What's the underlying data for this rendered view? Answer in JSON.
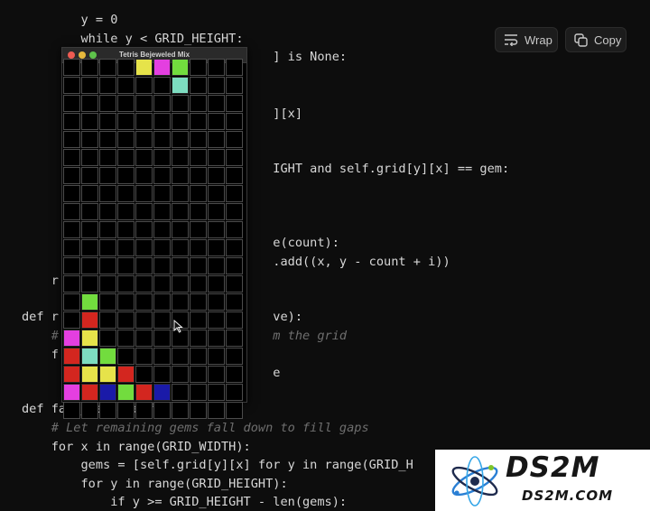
{
  "toolbar": {
    "wrap_label": "Wrap",
    "copy_label": "Copy"
  },
  "window": {
    "title": "Tetris Bejeweled Mix"
  },
  "code": {
    "lines": [
      "    for x in range(GRID_WIDTH):",
      "        y = 0",
      "        while y < GRID_HEIGHT:",
      "                                  ] is None:",
      "                                  ][x]",
      "                                  IGHT and self.grid[y][x] == gem:",
      "                                  e(count):",
      "                                  .add((x, y - count + i))",
      "    r",
      "def r                             ve):",
      "    #                             m the grid",
      "    f",
      "                                  e",
      "def fall_gems(self):",
      "    # Let remaining gems fall down to fill gaps",
      "    for x in range(GRID_WIDTH):",
      "        gems = [self.grid[y][x] for y in range(GRID_H",
      "        for y in range(GRID_HEIGHT):",
      "            if y >= GRID_HEIGHT - len(gems):"
    ]
  },
  "board": {
    "cols": 10,
    "rows": 20,
    "colors": {
      "Y": "#e6e34a",
      "M": "#e43fe0",
      "G": "#72dc3e",
      "C": "#7ddcc0",
      "R": "#d3261f",
      "B": "#1a1aa8"
    },
    "grid": [
      "....YMG...",
      "......C...",
      "..........",
      "..........",
      "..........",
      "..........",
      "..........",
      "..........",
      "..........",
      "..........",
      "..........",
      "..........",
      "..........",
      ".G........",
      ".R........",
      "MY........",
      "RCG.......",
      "RYYR......",
      "MRBGRB....",
      ".........."
    ]
  },
  "watermark": {
    "brand": "DS2M",
    "domain": "DS2M.COM"
  }
}
